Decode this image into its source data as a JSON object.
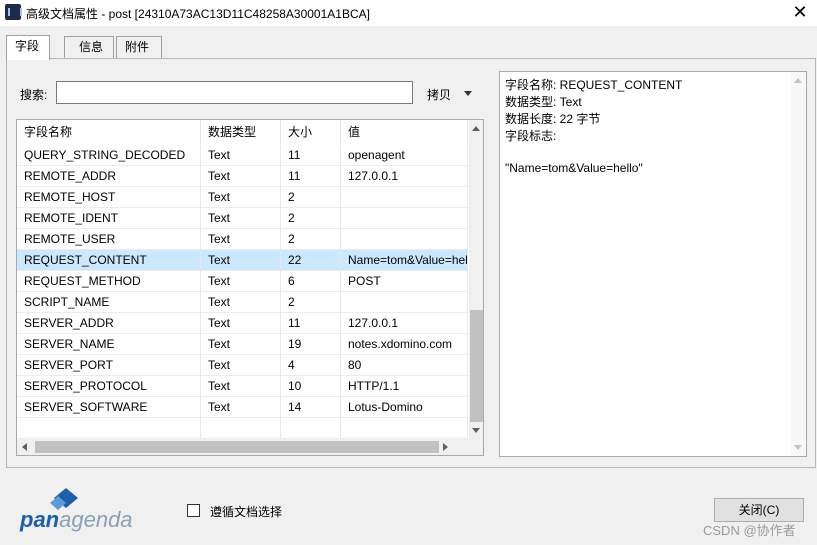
{
  "window": {
    "title": "高级文档属性 - post [24310A73AC13D11C48258A30001A1BCA]",
    "close_glyph": "✕"
  },
  "tabs": [
    {
      "label": "字段",
      "active": true
    },
    {
      "label": "信息",
      "active": false
    },
    {
      "label": "附件",
      "active": false
    }
  ],
  "search": {
    "label": "搜索:",
    "value": "",
    "placeholder": "",
    "copy_label": "拷贝"
  },
  "grid": {
    "columns": [
      "字段名称",
      "数据类型",
      "大小",
      "值"
    ],
    "rows": [
      {
        "name": "QUERY_STRING_DECODED",
        "type": "Text",
        "size": "11",
        "value": "openagent",
        "selected": false
      },
      {
        "name": "REMOTE_ADDR",
        "type": "Text",
        "size": "11",
        "value": "127.0.0.1",
        "selected": false
      },
      {
        "name": "REMOTE_HOST",
        "type": "Text",
        "size": "2",
        "value": "",
        "selected": false
      },
      {
        "name": "REMOTE_IDENT",
        "type": "Text",
        "size": "2",
        "value": "",
        "selected": false
      },
      {
        "name": "REMOTE_USER",
        "type": "Text",
        "size": "2",
        "value": "",
        "selected": false
      },
      {
        "name": "REQUEST_CONTENT",
        "type": "Text",
        "size": "22",
        "value": "Name=tom&Value=hello",
        "selected": true
      },
      {
        "name": "REQUEST_METHOD",
        "type": "Text",
        "size": "6",
        "value": "POST",
        "selected": false
      },
      {
        "name": "SCRIPT_NAME",
        "type": "Text",
        "size": "2",
        "value": "",
        "selected": false
      },
      {
        "name": "SERVER_ADDR",
        "type": "Text",
        "size": "11",
        "value": "127.0.0.1",
        "selected": false
      },
      {
        "name": "SERVER_NAME",
        "type": "Text",
        "size": "19",
        "value": "notes.xdomino.com",
        "selected": false
      },
      {
        "name": "SERVER_PORT",
        "type": "Text",
        "size": "4",
        "value": "80",
        "selected": false
      },
      {
        "name": "SERVER_PROTOCOL",
        "type": "Text",
        "size": "10",
        "value": "HTTP/1.1",
        "selected": false
      },
      {
        "name": "SERVER_SOFTWARE",
        "type": "Text",
        "size": "14",
        "value": "Lotus-Domino",
        "selected": false
      }
    ]
  },
  "detail": {
    "lines": [
      "字段名称: REQUEST_CONTENT",
      "数据类型: Text",
      "数据长度: 22 字节",
      "字段标志:",
      "",
      "\"Name=tom&Value=hello\""
    ]
  },
  "footer": {
    "logo_part1": "pan",
    "logo_part2": "agenda",
    "checkbox_label": "遵循文档选择",
    "checkbox_checked": false,
    "close_label": "关闭(C)",
    "watermark": "CSDN @协作者"
  },
  "colors": {
    "selection": "#cce8ff",
    "logo_blue": "#1e5fa8"
  }
}
